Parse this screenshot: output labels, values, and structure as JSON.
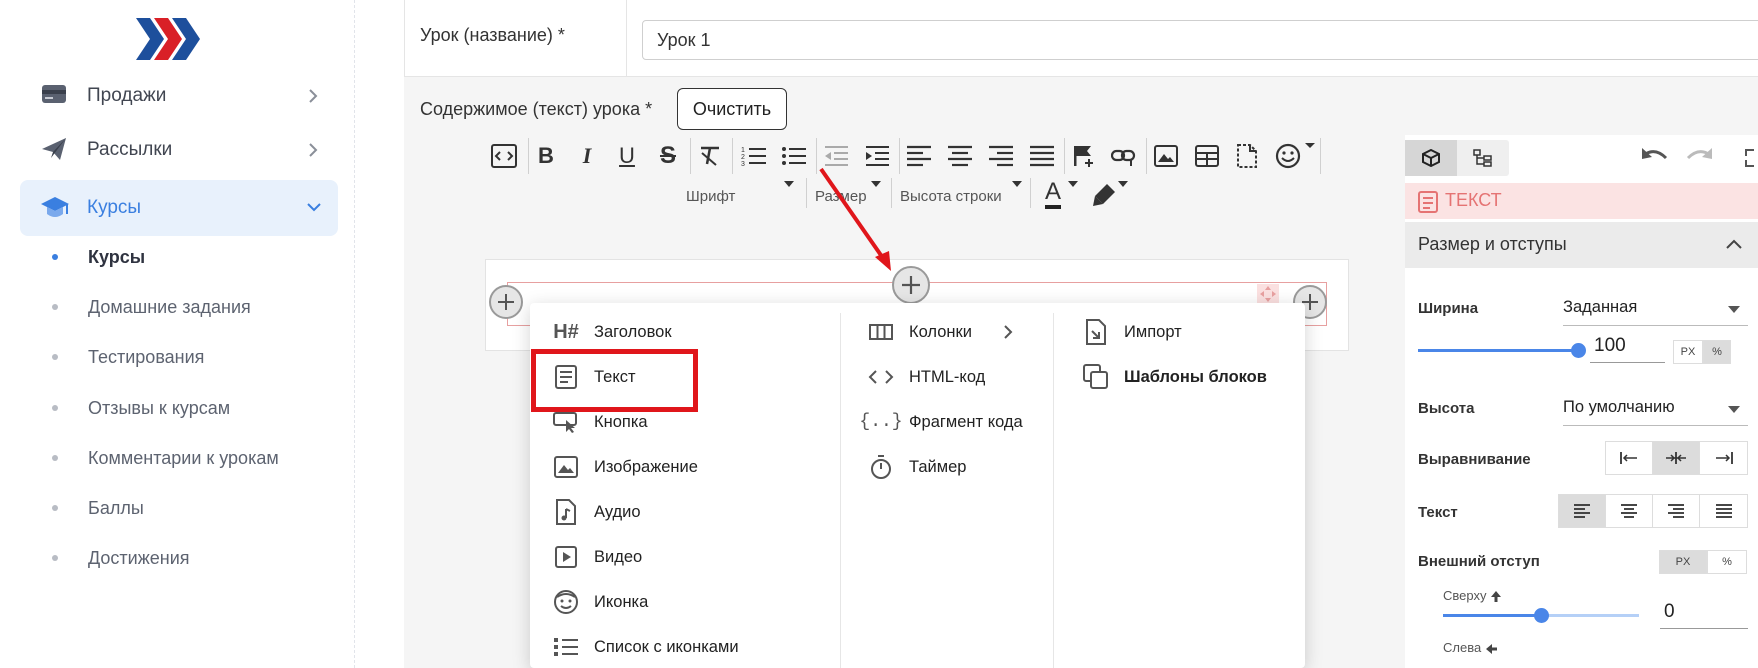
{
  "sidebar": {
    "menu": [
      {
        "label": "Продажи",
        "icon": "credit-card-icon"
      },
      {
        "label": "Рассылки",
        "icon": "paper-plane-icon"
      },
      {
        "label": "Курсы",
        "icon": "graduation-cap-icon"
      }
    ],
    "submenu": [
      {
        "label": "Курсы"
      },
      {
        "label": "Домашние задания"
      },
      {
        "label": "Тестирования"
      },
      {
        "label": "Отзывы к курсам"
      },
      {
        "label": "Комментарии к урокам"
      },
      {
        "label": "Баллы"
      },
      {
        "label": "Достижения"
      }
    ]
  },
  "form": {
    "lesson_label": "Урок (название) *",
    "lesson_value": "Урок 1",
    "content_label": "Содержимое (текст) урока *",
    "clear_button": "Очистить"
  },
  "toolbar": {
    "font_label": "Шрифт",
    "size_label": "Размер",
    "line_height_label": "Высота строки",
    "text_color_glyph": "A"
  },
  "popup": {
    "col1": [
      {
        "label": "Заголовок",
        "icon": "heading-icon"
      },
      {
        "label": "Текст",
        "icon": "text-icon"
      },
      {
        "label": "Кнопка",
        "icon": "button-icon"
      },
      {
        "label": "Изображение",
        "icon": "image-icon"
      },
      {
        "label": "Аудио",
        "icon": "audio-icon"
      },
      {
        "label": "Видео",
        "icon": "video-icon"
      },
      {
        "label": "Иконка",
        "icon": "smiley-icon"
      },
      {
        "label": "Список с иконками",
        "icon": "list-icon"
      }
    ],
    "col2": [
      {
        "label": "Колонки",
        "icon": "columns-icon"
      },
      {
        "label": "HTML-код",
        "icon": "code-icon"
      },
      {
        "label": "Фрагмент кода",
        "icon": "braces-icon"
      },
      {
        "label": "Таймер",
        "icon": "timer-icon"
      }
    ],
    "col3": [
      {
        "label": "Импорт",
        "icon": "import-icon"
      },
      {
        "label": "Шаблоны блоков",
        "icon": "templates-icon"
      }
    ]
  },
  "panel": {
    "element_type": "ТЕКСТ",
    "section_title": "Размер и отступы",
    "width_label": "Ширина",
    "width_mode": "Заданная",
    "width_value": "100",
    "unit_px": "PX",
    "unit_pct": "%",
    "height_label": "Высота",
    "height_mode": "По умолчанию",
    "align_label": "Выравнивание",
    "text_label": "Текст",
    "margin_label": "Внешний отступ",
    "top_label": "Сверху",
    "top_value": "0",
    "left_label": "Слева",
    "width_slider_level": 1.0,
    "top_slider_level": 0.5
  },
  "colors": {
    "accent": "#3a7fe0",
    "highlight": "#e0161b",
    "arrow": "#e0161b"
  }
}
